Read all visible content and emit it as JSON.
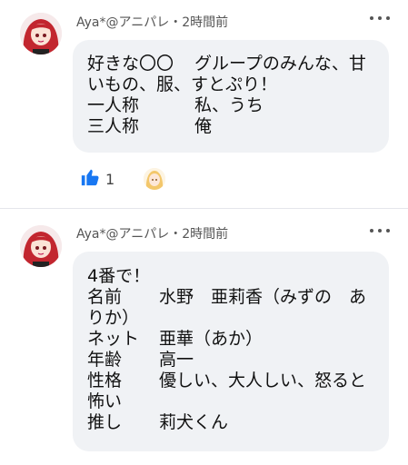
{
  "posts": [
    {
      "author": "Aya*@アニパレ",
      "separator": "・",
      "time": "2時間前",
      "lines": [
        {
          "label": "好きな〇〇",
          "value": "グループのみんな、甘"
        },
        {
          "label": "いもの、服、すとぷり！",
          "value": ""
        },
        {
          "label": "一人称",
          "value": "私、うち"
        },
        {
          "label": "三人称",
          "value": "俺"
        }
      ],
      "reactions": {
        "like_count": "1"
      }
    },
    {
      "author": "Aya*@アニパレ",
      "separator": "・",
      "time": "2時間前",
      "lines": [
        {
          "label": "4番で！",
          "value": ""
        },
        {
          "label": "名前",
          "value": "水野　亜莉香（みずの　あ"
        },
        {
          "label": "りか）",
          "value": ""
        },
        {
          "label": "ネット",
          "value": "亜華（あか）"
        },
        {
          "label": "年齢",
          "value": "高一"
        },
        {
          "label": "性格",
          "value": "優しい、大人しい、怒ると"
        },
        {
          "label": "怖い",
          "value": ""
        },
        {
          "label": "推し",
          "value": "莉犬くん"
        }
      ]
    }
  ],
  "colors": {
    "like": "#1877f2",
    "bubble": "#f0f2f5",
    "avatar_hair": "#c2262f"
  },
  "icons": [
    "more-dots-icon",
    "thumbs-up-icon",
    "reaction-avatar-icon"
  ]
}
